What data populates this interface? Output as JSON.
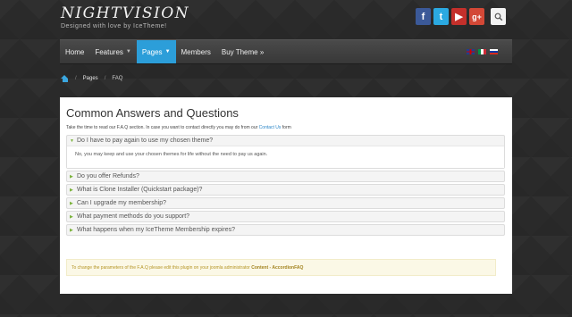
{
  "header": {
    "logo_title": "NIGHTVISION",
    "logo_tagline": "Designed with love by IceTheme!",
    "social": [
      {
        "name": "facebook-icon",
        "glyph": "f"
      },
      {
        "name": "twitter-icon",
        "glyph": "t"
      },
      {
        "name": "youtube-icon",
        "glyph": "▶"
      },
      {
        "name": "google-plus-icon",
        "glyph": "g+"
      }
    ],
    "search_glyph": "⌕"
  },
  "nav": {
    "items": [
      {
        "label": "Home",
        "active": false
      },
      {
        "label": "Features",
        "active": false,
        "dropdown": true
      },
      {
        "label": "Pages",
        "active": true,
        "dropdown": true
      },
      {
        "label": "Members",
        "active": false
      },
      {
        "label": "Buy Theme »",
        "active": false
      }
    ],
    "languages": [
      "English",
      "Italian",
      "Russian"
    ]
  },
  "breadcrumb": {
    "separator": "/",
    "items": [
      "Pages",
      "FAQ"
    ]
  },
  "main": {
    "title": "Common Answers and Questions",
    "intro_text": "Take the time to read our F.A.Q section. In case you want to contact directly you may do from our ",
    "intro_link": "Contact Us",
    "intro_suffix": " form",
    "faqs": [
      {
        "question": "Do I have to pay again to use my chosen theme?",
        "answer": "No, you may keep and use your chosen themes for life without the need to pay us again.",
        "open": true
      },
      {
        "question": "Do you offer Refunds?",
        "open": false
      },
      {
        "question": "What is Clone Installer (Quickstart package)?",
        "open": false
      },
      {
        "question": "Can I upgrade my membership?",
        "open": false
      },
      {
        "question": "What payment methods do you support?",
        "open": false
      },
      {
        "question": "What happens when my IceTheme Membership expires?",
        "open": false
      }
    ],
    "notice_text": "To change the parameters of the F.A.Q please edit this plugin on your joomla administrator ",
    "notice_bold": "Content - AccordionFAQ"
  },
  "colors": {
    "accent": "#2c9ed9",
    "background": "#2a2a2a",
    "notice_bg": "#fbf8e6",
    "notice_text": "#b59525"
  }
}
